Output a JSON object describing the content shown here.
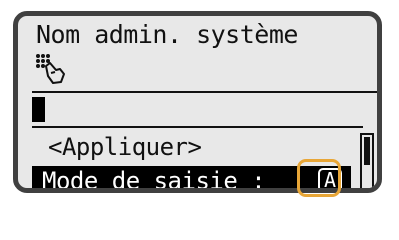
{
  "screen": {
    "title": "Nom admin. système",
    "icons": {
      "keypad": "keypad-hand-icon"
    },
    "input": {
      "value": ""
    },
    "menu": {
      "apply_label": "<Appliquer>",
      "input_mode_label": "Mode de saisie :",
      "input_mode_value": "A"
    },
    "colors": {
      "lcd_background": "#e8e8e8",
      "frame": "#404040",
      "highlight_callout": "#e8a637"
    }
  }
}
